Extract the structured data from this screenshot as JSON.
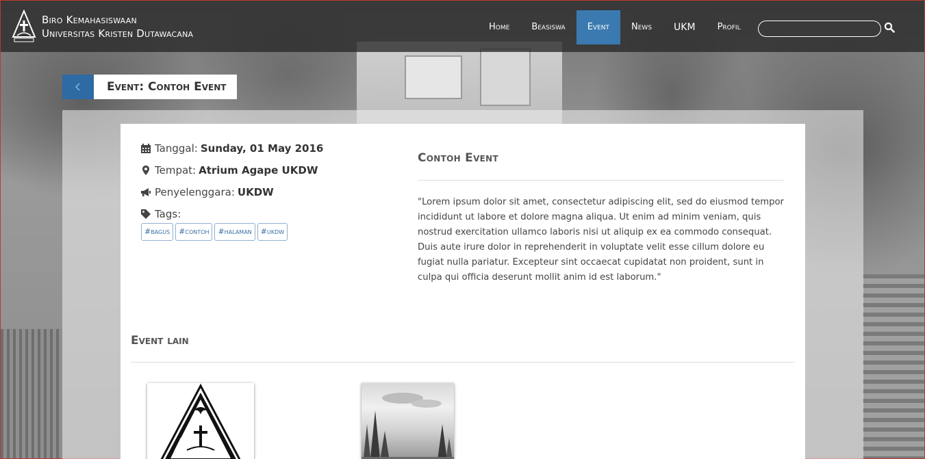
{
  "brand": {
    "line1": "Biro Kemahasiswaan",
    "line2": "Universitas Kristen Dutawacana"
  },
  "nav": {
    "items": [
      {
        "label": "Home"
      },
      {
        "label": "Beasiswa"
      },
      {
        "label": "Event"
      },
      {
        "label": "News"
      },
      {
        "label": "UKM"
      },
      {
        "label": "Profil"
      }
    ],
    "active_item": "Event",
    "search_placeholder": ""
  },
  "page": {
    "title": "Event: Contoh Event"
  },
  "meta": {
    "date_label": "Tanggal:",
    "date_value": "Sunday, 01 May 2016",
    "place_label": "Tempat:",
    "place_value": "Atrium Agape UKDW",
    "organizer_label": "Penyelenggara:",
    "organizer_value": "UKDW",
    "tags_label": "Tags:",
    "tags": [
      "#bagus",
      "#contoh",
      "#halaman",
      "#ukdw"
    ]
  },
  "event": {
    "title": "Contoh Event",
    "description": "\"Lorem ipsum dolor sit amet, consectetur adipiscing elit, sed do eiusmod tempor incididunt ut labore et dolore magna aliqua. Ut enim ad minim veniam, quis nostrud exercitation ullamco laboris nisi ut aliquip ex ea commodo consequat. Duis aute irure dolor in reprehenderit in voluptate velit esse cillum dolore eu fugiat nulla pariatur. Excepteur sint occaecat cupidatat non proident, sunt in culpa qui officia deserunt mollit anim id est laborum.\""
  },
  "other_events": {
    "title": "Event lain"
  },
  "colors": {
    "nav_active": "#3a7ab0",
    "back_button": "#2e6aa3",
    "tag_text": "#3a6ea5"
  },
  "icons": {
    "logo": "ukdw-logo-icon",
    "search": "search-icon",
    "back": "chevron-left-icon",
    "date": "calendar-icon",
    "place": "map-marker-icon",
    "organizer": "bullhorn-icon",
    "tags": "tag-icon"
  }
}
